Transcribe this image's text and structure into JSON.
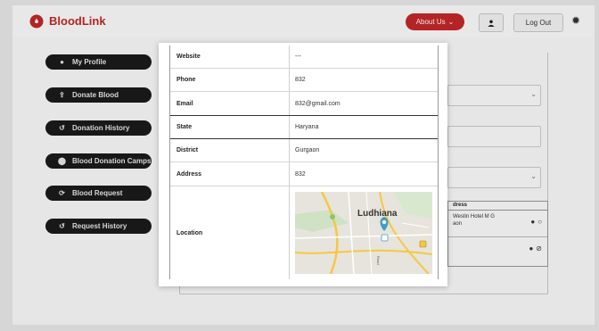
{
  "app": {
    "name": "BloodLink"
  },
  "header": {
    "about_label": "About Us",
    "logout_label": "Log Out"
  },
  "sidebar": {
    "items": [
      {
        "label": "My Profile",
        "icon": "user-icon"
      },
      {
        "label": "Donate Blood",
        "icon": "donate-icon"
      },
      {
        "label": "Donation History",
        "icon": "history-icon"
      },
      {
        "label": "Blood Donation Camps",
        "icon": "location-pin-icon"
      },
      {
        "label": "Blood Request",
        "icon": "refresh-icon"
      },
      {
        "label": "Request History",
        "icon": "history-icon"
      }
    ]
  },
  "background_table": {
    "header": "dress",
    "rows": [
      {
        "address_line1": "Westin Hotel M G",
        "address_line2": "aon",
        "status_icon": "empty-circle-icon"
      },
      {
        "address_line1": "",
        "address_line2": "",
        "status_icon": "check-circle-icon"
      }
    ]
  },
  "modal": {
    "rows": [
      {
        "label": "Website",
        "value": "---"
      },
      {
        "label": "Phone",
        "value": "832"
      },
      {
        "label": "Email",
        "value": "832@gmail.com"
      },
      {
        "label": "State",
        "value": "Haryana"
      },
      {
        "label": "District",
        "value": "Gurgaon"
      },
      {
        "label": "Address",
        "value": "832"
      },
      {
        "label": "Location",
        "value": ""
      }
    ],
    "map": {
      "city_label": "Ludhiana",
      "road_label": "Road",
      "colors": {
        "land": "#e7e4dd",
        "road": "#f5c842",
        "park": "#b8d9a6",
        "pin": "#3d9fc2"
      }
    }
  },
  "colors": {
    "brand": "#c62828",
    "sidebar_bg": "#1b1b1b"
  }
}
